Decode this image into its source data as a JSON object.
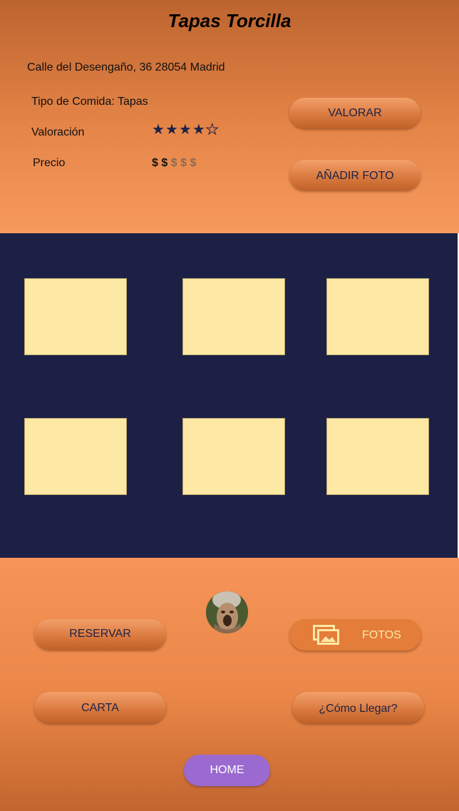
{
  "header": {
    "title": "Tapas Torcilla",
    "address": "Calle del Desengaño, 36 28054 Madrid"
  },
  "details": {
    "food_type": "Tipo de Comida: Tapas",
    "rating_label": "Valoración",
    "rating_value": 4,
    "rating_max": 5,
    "price_label": "Precio",
    "price_level": 2,
    "price_max": 5
  },
  "actions": {
    "rate": "VALORAR",
    "add_photo": "AÑADIR FOTO"
  },
  "gallery": {
    "photo_count": 6
  },
  "menu": {
    "reserve": "RESERVAR",
    "photos": "FOTOS",
    "photos_icon": "images-icon",
    "menu_card": "CARTA",
    "directions": "¿Cómo Llegar?",
    "home": "HOME"
  },
  "colors": {
    "navy": "#1c2045",
    "photo_placeholder": "#fde8a4",
    "accent_orange": "#e47d3a",
    "home_purple": "#9a6ad0"
  }
}
